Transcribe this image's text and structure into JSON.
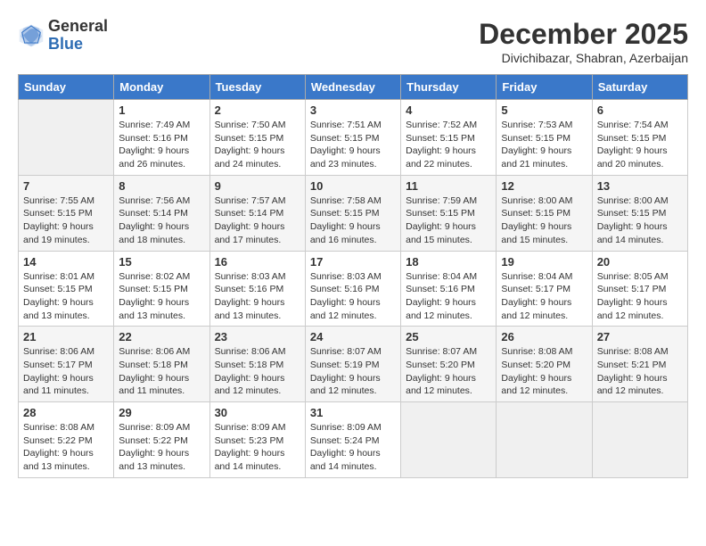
{
  "logo": {
    "general": "General",
    "blue": "Blue"
  },
  "header": {
    "month": "December 2025",
    "location": "Divichibazar, Shabran, Azerbaijan"
  },
  "weekdays": [
    "Sunday",
    "Monday",
    "Tuesday",
    "Wednesday",
    "Thursday",
    "Friday",
    "Saturday"
  ],
  "weeks": [
    [
      {
        "day": null
      },
      {
        "day": 1,
        "sunrise": "7:49 AM",
        "sunset": "5:16 PM",
        "daylight": "9 hours and 26 minutes."
      },
      {
        "day": 2,
        "sunrise": "7:50 AM",
        "sunset": "5:15 PM",
        "daylight": "9 hours and 24 minutes."
      },
      {
        "day": 3,
        "sunrise": "7:51 AM",
        "sunset": "5:15 PM",
        "daylight": "9 hours and 23 minutes."
      },
      {
        "day": 4,
        "sunrise": "7:52 AM",
        "sunset": "5:15 PM",
        "daylight": "9 hours and 22 minutes."
      },
      {
        "day": 5,
        "sunrise": "7:53 AM",
        "sunset": "5:15 PM",
        "daylight": "9 hours and 21 minutes."
      },
      {
        "day": 6,
        "sunrise": "7:54 AM",
        "sunset": "5:15 PM",
        "daylight": "9 hours and 20 minutes."
      }
    ],
    [
      {
        "day": 7,
        "sunrise": "7:55 AM",
        "sunset": "5:15 PM",
        "daylight": "9 hours and 19 minutes."
      },
      {
        "day": 8,
        "sunrise": "7:56 AM",
        "sunset": "5:14 PM",
        "daylight": "9 hours and 18 minutes."
      },
      {
        "day": 9,
        "sunrise": "7:57 AM",
        "sunset": "5:14 PM",
        "daylight": "9 hours and 17 minutes."
      },
      {
        "day": 10,
        "sunrise": "7:58 AM",
        "sunset": "5:15 PM",
        "daylight": "9 hours and 16 minutes."
      },
      {
        "day": 11,
        "sunrise": "7:59 AM",
        "sunset": "5:15 PM",
        "daylight": "9 hours and 15 minutes."
      },
      {
        "day": 12,
        "sunrise": "8:00 AM",
        "sunset": "5:15 PM",
        "daylight": "9 hours and 15 minutes."
      },
      {
        "day": 13,
        "sunrise": "8:00 AM",
        "sunset": "5:15 PM",
        "daylight": "9 hours and 14 minutes."
      }
    ],
    [
      {
        "day": 14,
        "sunrise": "8:01 AM",
        "sunset": "5:15 PM",
        "daylight": "9 hours and 13 minutes."
      },
      {
        "day": 15,
        "sunrise": "8:02 AM",
        "sunset": "5:15 PM",
        "daylight": "9 hours and 13 minutes."
      },
      {
        "day": 16,
        "sunrise": "8:03 AM",
        "sunset": "5:16 PM",
        "daylight": "9 hours and 13 minutes."
      },
      {
        "day": 17,
        "sunrise": "8:03 AM",
        "sunset": "5:16 PM",
        "daylight": "9 hours and 12 minutes."
      },
      {
        "day": 18,
        "sunrise": "8:04 AM",
        "sunset": "5:16 PM",
        "daylight": "9 hours and 12 minutes."
      },
      {
        "day": 19,
        "sunrise": "8:04 AM",
        "sunset": "5:17 PM",
        "daylight": "9 hours and 12 minutes."
      },
      {
        "day": 20,
        "sunrise": "8:05 AM",
        "sunset": "5:17 PM",
        "daylight": "9 hours and 12 minutes."
      }
    ],
    [
      {
        "day": 21,
        "sunrise": "8:06 AM",
        "sunset": "5:17 PM",
        "daylight": "9 hours and 11 minutes."
      },
      {
        "day": 22,
        "sunrise": "8:06 AM",
        "sunset": "5:18 PM",
        "daylight": "9 hours and 11 minutes."
      },
      {
        "day": 23,
        "sunrise": "8:06 AM",
        "sunset": "5:18 PM",
        "daylight": "9 hours and 12 minutes."
      },
      {
        "day": 24,
        "sunrise": "8:07 AM",
        "sunset": "5:19 PM",
        "daylight": "9 hours and 12 minutes."
      },
      {
        "day": 25,
        "sunrise": "8:07 AM",
        "sunset": "5:20 PM",
        "daylight": "9 hours and 12 minutes."
      },
      {
        "day": 26,
        "sunrise": "8:08 AM",
        "sunset": "5:20 PM",
        "daylight": "9 hours and 12 minutes."
      },
      {
        "day": 27,
        "sunrise": "8:08 AM",
        "sunset": "5:21 PM",
        "daylight": "9 hours and 12 minutes."
      }
    ],
    [
      {
        "day": 28,
        "sunrise": "8:08 AM",
        "sunset": "5:22 PM",
        "daylight": "9 hours and 13 minutes."
      },
      {
        "day": 29,
        "sunrise": "8:09 AM",
        "sunset": "5:22 PM",
        "daylight": "9 hours and 13 minutes."
      },
      {
        "day": 30,
        "sunrise": "8:09 AM",
        "sunset": "5:23 PM",
        "daylight": "9 hours and 14 minutes."
      },
      {
        "day": 31,
        "sunrise": "8:09 AM",
        "sunset": "5:24 PM",
        "daylight": "9 hours and 14 minutes."
      },
      {
        "day": null
      },
      {
        "day": null
      },
      {
        "day": null
      }
    ]
  ]
}
